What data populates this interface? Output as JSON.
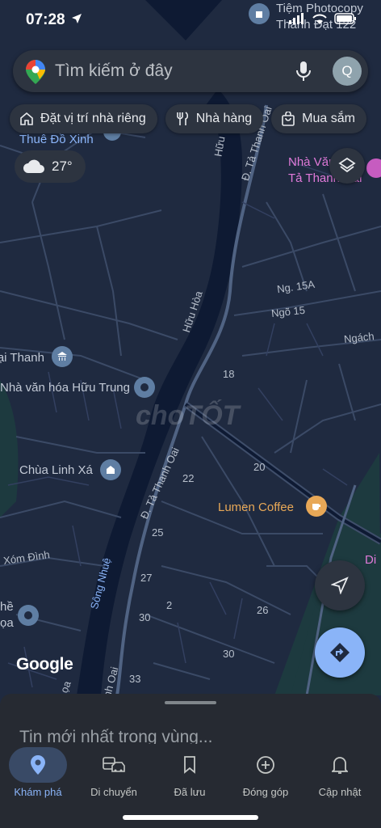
{
  "status_bar": {
    "time": "07:28"
  },
  "search": {
    "placeholder": "Tìm kiếm ở đây",
    "avatar_letter": "Q"
  },
  "chips": [
    {
      "icon": "home-icon",
      "label": "Đặt vị trí nhà riêng"
    },
    {
      "icon": "restaurant-icon",
      "label": "Nhà hàng"
    },
    {
      "icon": "shopping-bag-icon",
      "label": "Mua sắm"
    }
  ],
  "weather": {
    "icon": "cloud-icon",
    "temp": "27°"
  },
  "map_labels": {
    "photocopy_1": "Tiệm Photocopy",
    "photocopy_2": "Thành Đạt 122",
    "thue_do": "Thuê Đồ Xinh",
    "nha_van_1": "Nhà Văn",
    "nha_van_2": "Tả Thanh Oai",
    "huu_hoa_1": "Hữu Hòa",
    "huu_hoa_2": "Hữu Hòa",
    "ta_thanh_oai_top": "Đ. Tả Thanh Oai",
    "ta_thanh_oai_mid": "Đ. Tả Thanh Oai",
    "ta_thanh_oai_bottom": "Tả Thanh Oai",
    "ng15a": "Ng. 15A",
    "ngo15": "Ngõ 15",
    "ngach": "Ngách",
    "dai_thanh": "Đại Thanh",
    "nha_van_hoa_huu_trung": "Nhà văn hóa Hữu Trung",
    "chua_linh_xa": "Chùa Linh Xá",
    "lumen": "Lumen Coffee",
    "xom_dinh": "Xóm Đình",
    "song_nhue": "Sông Nhuệ",
    "left_edge_1": "hề",
    "left_edge_2": "ọa",
    "di": "Di",
    "bottom_left": "ọa",
    "bottom_oai": "nh Oai"
  },
  "house_numbers": [
    "18",
    "20",
    "22",
    "25",
    "27",
    "2",
    "30",
    "26",
    "30",
    "33"
  ],
  "watermark": "choTỐT",
  "google": "Google",
  "sheet": {
    "title": "Tin mới nhất trong vùng..."
  },
  "tabs": [
    {
      "icon": "explore-pin-icon",
      "label": "Khám phá",
      "active": true
    },
    {
      "icon": "commute-icon",
      "label": "Di chuyển",
      "active": false
    },
    {
      "icon": "bookmark-icon",
      "label": "Đã lưu",
      "active": false
    },
    {
      "icon": "add-circle-icon",
      "label": "Đóng góp",
      "active": false
    },
    {
      "icon": "bell-icon",
      "label": "Cập nhật",
      "active": false
    }
  ],
  "colors": {
    "map_bg": "#1f2a40",
    "river": "#0e1a33",
    "road": "#4a5a78",
    "accent": "#8ab4f8"
  }
}
